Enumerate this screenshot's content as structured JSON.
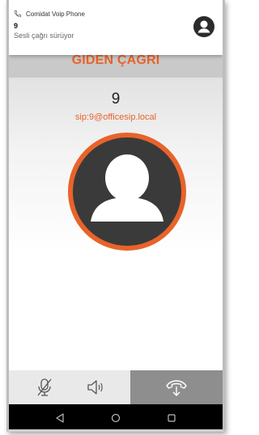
{
  "notification": {
    "app_name": "Comidat Voip Phone",
    "caller": "9",
    "status": "Sesli çağrı sürüyor",
    "icon": "phone-icon",
    "avatar_icon": "person-icon"
  },
  "call": {
    "title": "GİDEN ÇAĞRI",
    "number": "9",
    "sip_address": "sip:9@officesip.local",
    "avatar_icon": "person-icon"
  },
  "controls": {
    "mute_icon": "mic-muted-icon",
    "speaker_icon": "speaker-icon",
    "hangup_icon": "hang-up-icon"
  },
  "navbar": {
    "back_icon": "back-icon",
    "home_icon": "home-icon",
    "recents_icon": "recents-icon"
  },
  "colors": {
    "accent": "#e8632a",
    "avatar_dark": "#3a3a3a",
    "control_bar": "#e9e9e9",
    "hangup_bg": "#8e8e8e",
    "nav_bar": "#000000"
  }
}
